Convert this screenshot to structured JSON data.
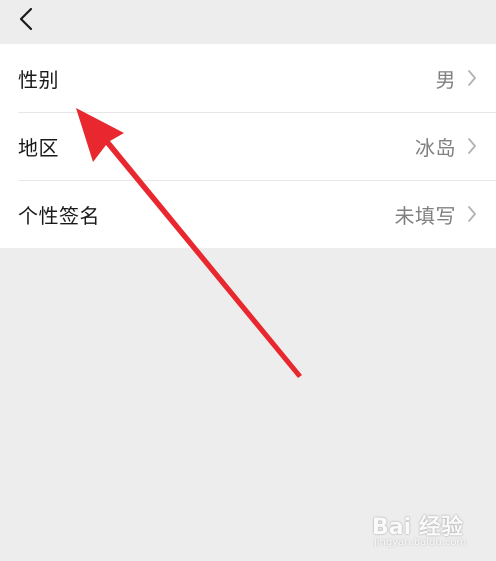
{
  "nav": {
    "back_icon": "chevron-left-icon"
  },
  "settings": {
    "rows": [
      {
        "label": "性别",
        "value": "男"
      },
      {
        "label": "地区",
        "value": "冰岛"
      },
      {
        "label": "个性签名",
        "value": "未填写"
      }
    ]
  },
  "annotation": {
    "type": "red-arrow",
    "color": "#e8282e",
    "points_to": "性别"
  },
  "watermark": {
    "text": "Bai 经验",
    "subtext": "jingyan.baidu.com"
  },
  "colors": {
    "background": "#ededed",
    "row_background": "#ffffff",
    "label": "#1a1a1a",
    "value": "#808080",
    "divider": "#e7e7e7"
  }
}
